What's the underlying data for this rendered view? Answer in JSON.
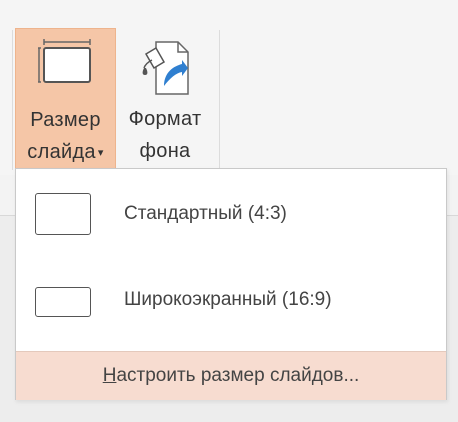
{
  "ribbon": {
    "slide_size": {
      "label_line1": "Размер",
      "label_line2": "слайда",
      "caret": "▾",
      "icon": "slide-size-icon"
    },
    "format_background": {
      "label_line1": "Формат",
      "label_line2": "фона",
      "icon": "format-background-icon"
    }
  },
  "menu": {
    "items": [
      {
        "label": "Стандартный (4:3)",
        "icon": "slide-4x3-icon"
      },
      {
        "label": "Широкоэкранный (16:9)",
        "icon": "slide-16x9-icon"
      }
    ],
    "custom_label": "Настроить размер слайдов..."
  },
  "colors": {
    "highlight": "#f5c6a7",
    "footer_highlight": "#f7dcd0"
  }
}
